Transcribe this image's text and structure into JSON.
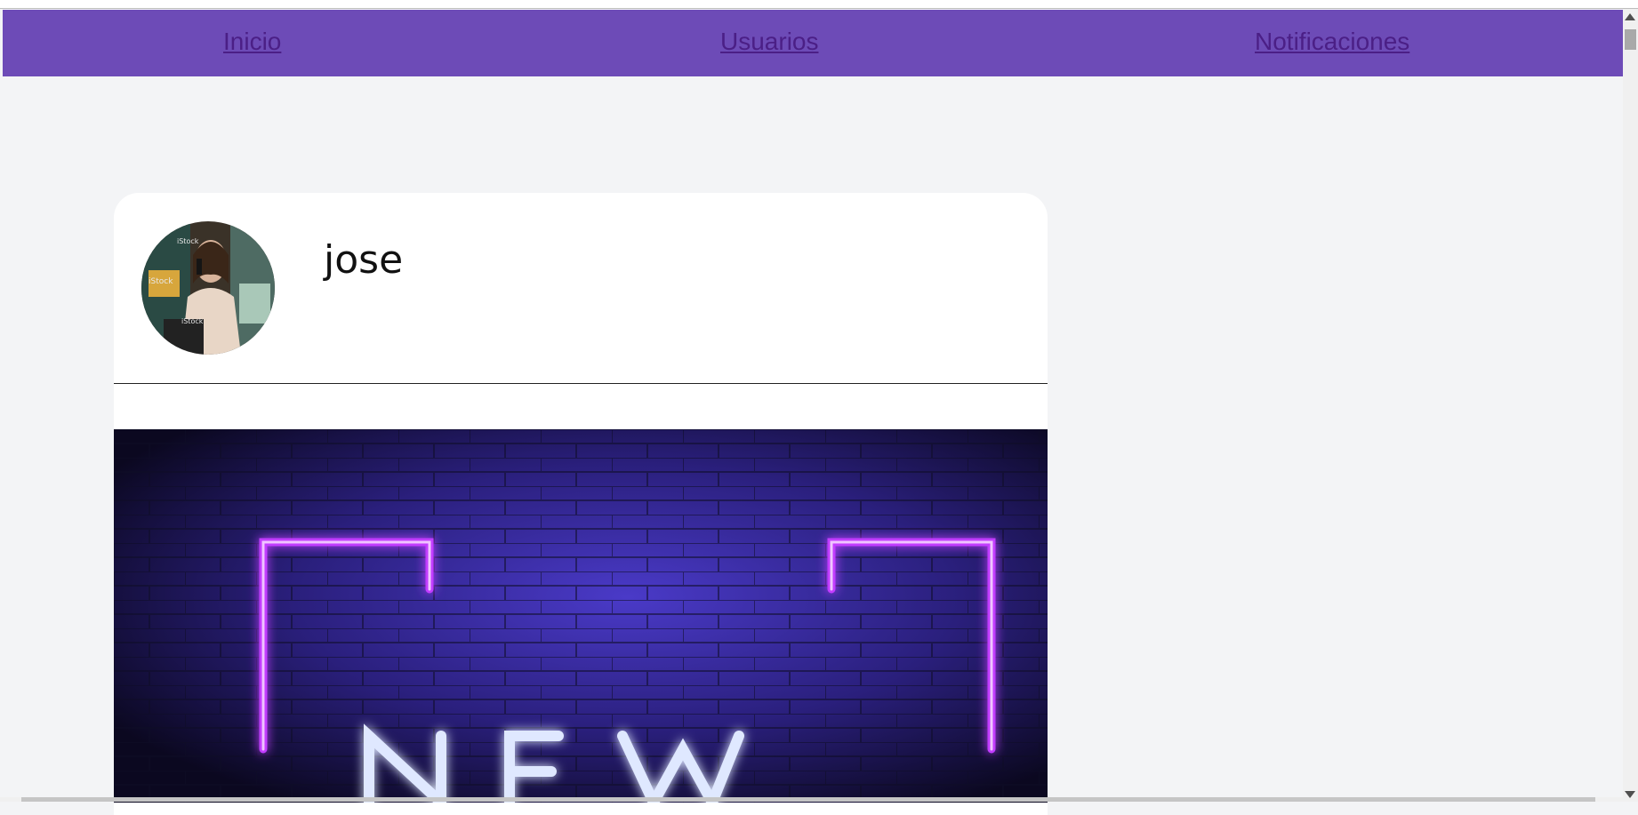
{
  "nav": {
    "items": [
      {
        "label": "Inicio"
      },
      {
        "label": "Usuarios"
      },
      {
        "label": "Notificaciones"
      }
    ]
  },
  "post": {
    "username": "jose",
    "avatar_icon": "profile-photo-icon"
  },
  "colors": {
    "nav_background": "#6d4bb7",
    "nav_link": "#4b1f86",
    "page_background": "#f3f4f6",
    "neon_purple": "#c23cff"
  }
}
